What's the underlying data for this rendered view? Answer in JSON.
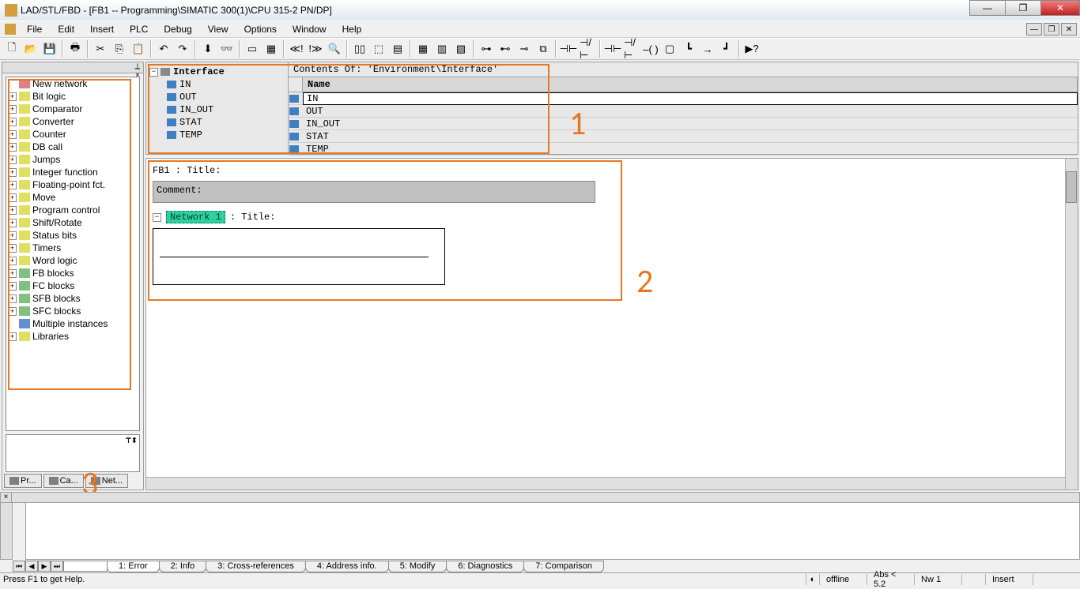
{
  "window": {
    "title": "LAD/STL/FBD  - [FB1 -- Programming\\SIMATIC 300(1)\\CPU 315-2 PN/DP]"
  },
  "menu": {
    "file": "File",
    "edit": "Edit",
    "insert": "Insert",
    "plc": "PLC",
    "debug": "Debug",
    "view": "View",
    "options": "Options",
    "window": "Window",
    "help": "Help"
  },
  "sidebar": {
    "items": [
      {
        "label": "New network"
      },
      {
        "label": "Bit logic"
      },
      {
        "label": "Comparator"
      },
      {
        "label": "Converter"
      },
      {
        "label": "Counter"
      },
      {
        "label": "DB call"
      },
      {
        "label": "Jumps"
      },
      {
        "label": "Integer function"
      },
      {
        "label": "Floating-point fct."
      },
      {
        "label": "Move"
      },
      {
        "label": "Program control"
      },
      {
        "label": "Shift/Rotate"
      },
      {
        "label": "Status bits"
      },
      {
        "label": "Timers"
      },
      {
        "label": "Word logic"
      },
      {
        "label": "FB blocks"
      },
      {
        "label": "FC blocks"
      },
      {
        "label": "SFB blocks"
      },
      {
        "label": "SFC blocks"
      },
      {
        "label": "Multiple instances"
      },
      {
        "label": "Libraries"
      }
    ],
    "tabs": {
      "pr": "Pr...",
      "ca": "Ca...",
      "net": "Net..."
    }
  },
  "interface": {
    "root": "Interface",
    "contents_header": "Contents Of: 'Environment\\Interface'",
    "name_col": "Name",
    "rows": [
      "IN",
      "OUT",
      "IN_OUT",
      "STAT",
      "TEMP"
    ]
  },
  "editor": {
    "fb_title": "FB1 : Title:",
    "comment_label": "Comment:",
    "network_label": "Network 1",
    "network_title_suffix": ": Title:"
  },
  "bottom_tabs": [
    "1: Error",
    "2: Info",
    "3: Cross-references",
    "4: Address info.",
    "5: Modify",
    "6: Diagnostics",
    "7: Comparison"
  ],
  "status": {
    "help": "Press F1 to get Help.",
    "offline": "offline",
    "abs": "Abs < 5.2",
    "nw": "Nw 1",
    "insert": "Insert"
  },
  "annotations": {
    "a1": "1",
    "a2": "2",
    "a3": "3"
  }
}
